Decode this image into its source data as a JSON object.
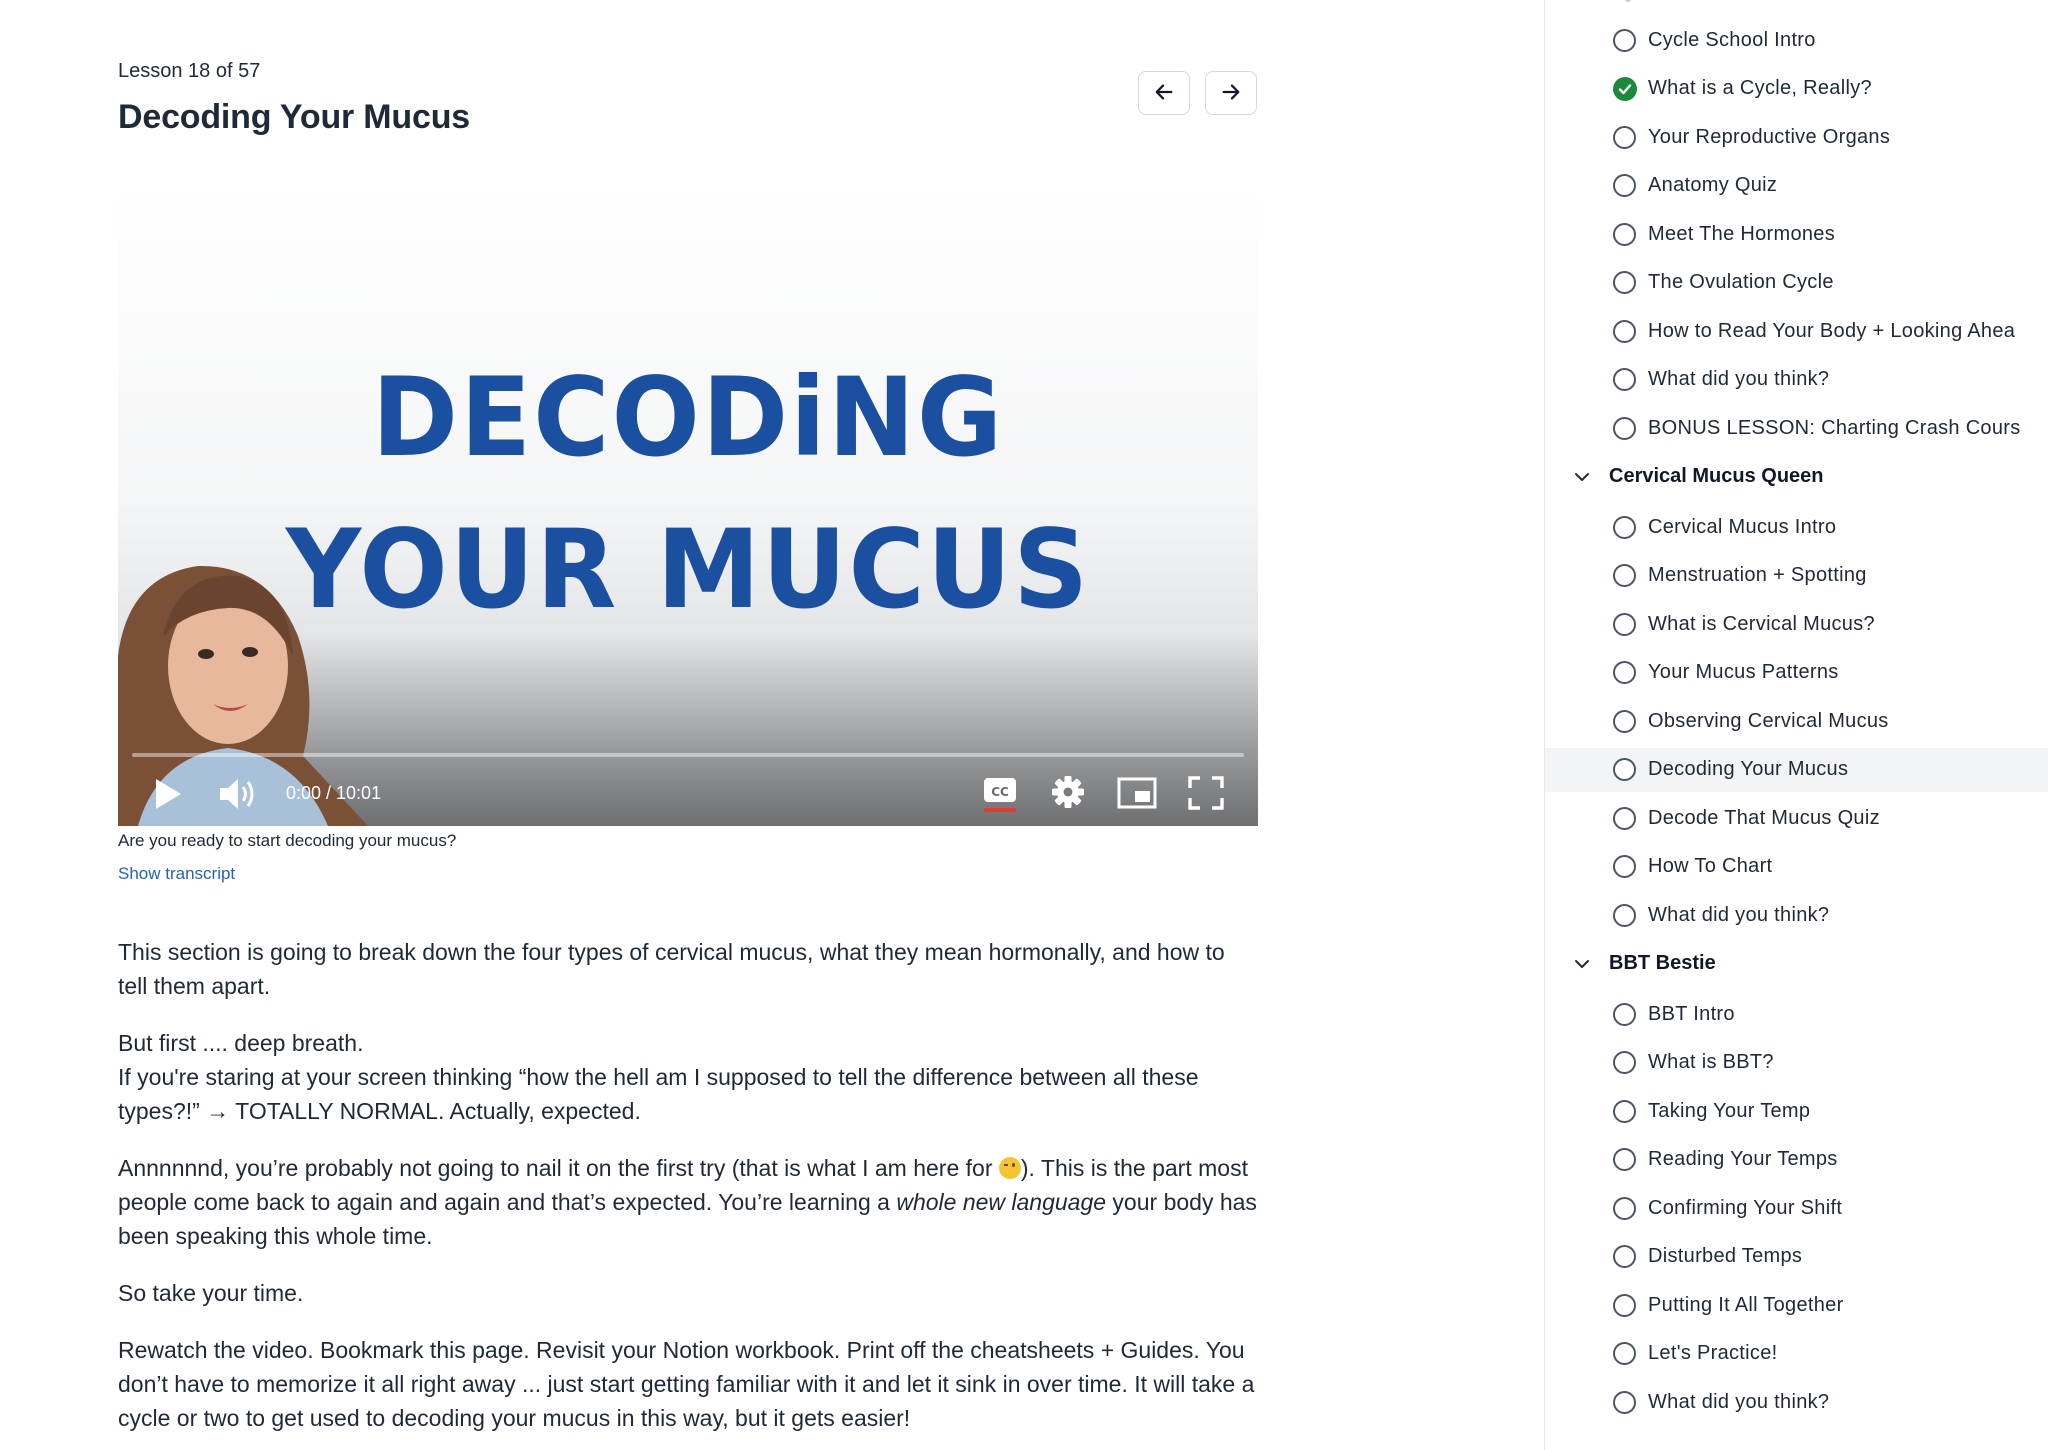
{
  "lesson": {
    "counter": "Lesson 18 of 57",
    "title": "Decoding Your Mucus"
  },
  "nav": {
    "prev_icon": "arrow-left-icon",
    "next_icon": "arrow-right-icon"
  },
  "video": {
    "title_line1": "DECODiNG",
    "title_line2": "YOUR MUCUS",
    "time": "0:00 / 10:01",
    "progress": 0,
    "cc_label": "CC",
    "title_color": "#1b4fa0"
  },
  "caption": "Are you ready to start decoding your mucus?",
  "transcript_link": "Show transcript",
  "body": {
    "p1": "This section is going to break down the four types of cervical mucus, what they mean hormonally, and how to tell them apart.",
    "p2a": "But first .... deep breath.",
    "p2b": "If you're staring at your screen thinking “how the hell am I supposed to tell the difference between all these types?!” → TOTALLY NORMAL. Actually, expected.",
    "p3a": "Annnnnnd, you’re probably not going to nail it on the first try (that is what I am here for ",
    "p3b": "). This is the part most people come back to again and again and that’s expected. You’re learning a ",
    "p3c": "whole new language",
    "p3d": " your body has been speaking this whole time.",
    "p4": "So take your time.",
    "p5": "Rewatch the video. Bookmark this page. Revisit your Notion workbook. Print off the cheatsheets + Guides.  You don’t have to memorize it all right away ... just start getting familiar with it and let it sink in over time. It will take a cycle or two to get used to decoding your mucus in this way, but it gets easier!"
  },
  "sidebar": {
    "group1_items": [
      {
        "label": "Cycle School Intro",
        "done": false
      },
      {
        "label": "What is a Cycle, Really?",
        "done": true
      },
      {
        "label": "Your Reproductive Organs",
        "done": false
      },
      {
        "label": "Anatomy Quiz",
        "done": false
      },
      {
        "label": "Meet The Hormones",
        "done": false
      },
      {
        "label": "The Ovulation Cycle",
        "done": false
      },
      {
        "label": "How to Read Your Body + Looking Ahea",
        "done": false
      },
      {
        "label": "What did you think?",
        "done": false
      },
      {
        "label": "BONUS LESSON: Charting Crash Cours",
        "done": false
      }
    ],
    "section2": "Cervical Mucus Queen",
    "group2_items": [
      {
        "label": "Cervical Mucus Intro",
        "done": false
      },
      {
        "label": "Menstruation + Spotting",
        "done": false
      },
      {
        "label": "What is Cervical Mucus?",
        "done": false
      },
      {
        "label": "Your Mucus Patterns",
        "done": false
      },
      {
        "label": "Observing Cervical Mucus",
        "done": false
      },
      {
        "label": "Decoding Your Mucus",
        "done": false,
        "active": true
      },
      {
        "label": "Decode That Mucus Quiz",
        "done": false
      },
      {
        "label": "How To Chart",
        "done": false
      },
      {
        "label": "What did you think?",
        "done": false
      }
    ],
    "section3": "BBT Bestie",
    "group3_items": [
      {
        "label": "BBT Intro",
        "done": false
      },
      {
        "label": "What is BBT?",
        "done": false
      },
      {
        "label": "Taking Your Temp",
        "done": false
      },
      {
        "label": "Reading Your Temps",
        "done": false
      },
      {
        "label": "Confirming Your Shift",
        "done": false
      },
      {
        "label": "Disturbed Temps",
        "done": false
      },
      {
        "label": "Putting It All Together",
        "done": false
      },
      {
        "label": "Let's Practice!",
        "done": false
      },
      {
        "label": "What did you think?",
        "done": false
      }
    ],
    "complete_color": "#1b8a3a"
  }
}
